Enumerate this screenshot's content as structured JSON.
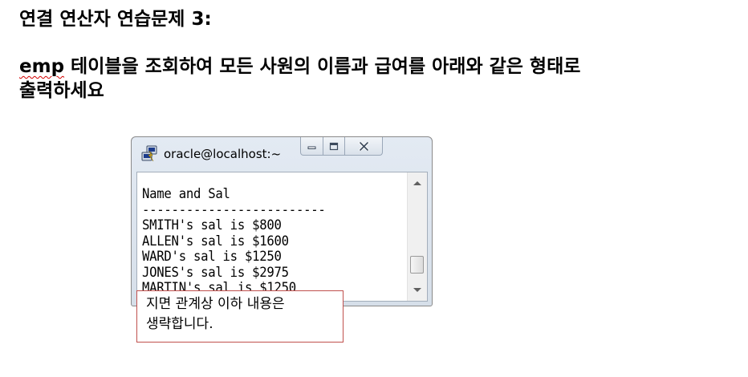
{
  "document": {
    "title": "연결 연산자 연습문제 3:",
    "question": {
      "highlighted_word": "emp",
      "line1_rest": " 테이블을 조회하여 모든 사원의 이름과 급여를 아래와 같은 형태로",
      "line2": "출력하세요"
    }
  },
  "window": {
    "title": "oracle@localhost:~",
    "app_icon": "putty-icon",
    "controls": {
      "minimize_icon": "minimize-icon",
      "maximize_icon": "maximize-icon",
      "close_icon": "close-icon"
    },
    "scroll_position": 0.87,
    "terminal_lines": [
      "Name and Sal",
      "-------------------------",
      "SMITH's sal is $800",
      "ALLEN's sal is $1600",
      "WARD's sal is $1250",
      "JONES's sal is $2975",
      "MARTIN's sal is $1250"
    ]
  },
  "note": {
    "line1": "지면 관계상 이하 내용은",
    "line2": "생략합니다.",
    "border_color": "#c0504d"
  }
}
